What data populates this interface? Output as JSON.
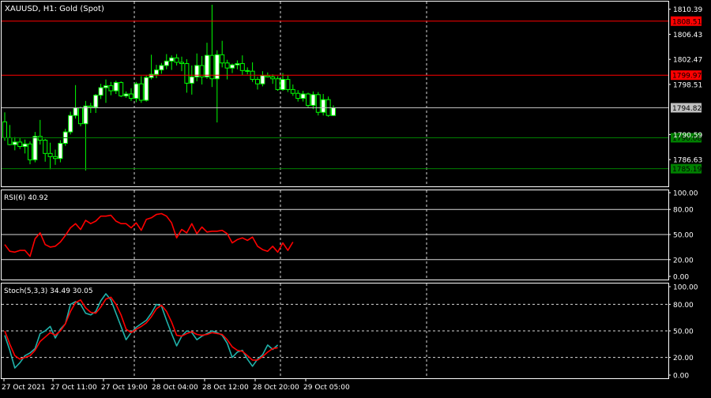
{
  "header": {
    "symbol": "XAUUSD",
    "timeframe": "H1",
    "description": "Gold (Spot)",
    "title_text": "XAUUSD, H1:  Gold (Spot)"
  },
  "colors": {
    "background": "#000000",
    "grid": "#ffffff",
    "bull_candle": "#ffffff",
    "bear_candle": "#000000",
    "wick": "#00ff00",
    "resistance_line": "#ff0000",
    "support_line": "#008000",
    "rsi_line": "#ff0000",
    "stoch_main": "#20b2aa",
    "stoch_signal": "#ff0000",
    "text": "#ffffff",
    "current_price_box": "#c0c0c0"
  },
  "chart_data": [
    {
      "type": "candlestick",
      "name": "price",
      "ylim": [
        1782.4,
        1811.6
      ],
      "y_ticks": [
        "1810.39",
        "1806.43",
        "1802.47",
        "1798.51",
        "1790.59",
        "1786.63"
      ],
      "horizontal_levels": [
        {
          "label": "1808.51",
          "kind": "resistance"
        },
        {
          "label": "1799.97",
          "kind": "resistance"
        },
        {
          "label": "1794.82",
          "kind": "current"
        },
        {
          "label": "1790.08",
          "kind": "support"
        },
        {
          "label": "1785.19",
          "kind": "support"
        }
      ],
      "candles": [
        [
          1792.6,
          1794.1,
          1789.6,
          1790.1
        ],
        [
          1790.1,
          1792.1,
          1788.9,
          1789.0
        ],
        [
          1789.0,
          1790.2,
          1788.1,
          1789.4
        ],
        [
          1789.4,
          1790.0,
          1788.3,
          1788.7
        ],
        [
          1788.7,
          1789.8,
          1787.6,
          1789.1
        ],
        [
          1789.1,
          1789.5,
          1785.9,
          1786.6
        ],
        [
          1786.6,
          1791.0,
          1786.2,
          1790.3
        ],
        [
          1790.3,
          1792.9,
          1789.0,
          1789.7
        ],
        [
          1789.7,
          1789.9,
          1786.3,
          1787.6
        ],
        [
          1787.6,
          1789.3,
          1785.1,
          1787.1
        ],
        [
          1787.1,
          1788.2,
          1785.8,
          1786.8
        ],
        [
          1786.8,
          1789.7,
          1786.2,
          1789.2
        ],
        [
          1789.2,
          1791.5,
          1788.8,
          1791.0
        ],
        [
          1791.0,
          1794.2,
          1790.6,
          1793.6
        ],
        [
          1793.6,
          1798.4,
          1793.1,
          1794.8
        ],
        [
          1794.8,
          1795.0,
          1791.9,
          1792.3
        ],
        [
          1792.3,
          1795.9,
          1784.9,
          1795.1
        ],
        [
          1795.1,
          1795.6,
          1794.0,
          1794.9
        ],
        [
          1794.9,
          1797.0,
          1794.0,
          1796.8
        ],
        [
          1796.8,
          1798.6,
          1796.2,
          1798.0
        ],
        [
          1798.0,
          1799.3,
          1795.6,
          1798.3
        ],
        [
          1798.3,
          1798.9,
          1796.8,
          1797.5
        ],
        [
          1797.5,
          1799.1,
          1797.0,
          1798.8
        ],
        [
          1798.8,
          1799.0,
          1796.5,
          1796.7
        ],
        [
          1796.7,
          1797.4,
          1796.4,
          1797.0
        ],
        [
          1797.0,
          1797.9,
          1795.9,
          1796.3
        ],
        [
          1796.3,
          1798.9,
          1795.7,
          1798.6
        ],
        [
          1798.6,
          1799.8,
          1795.6,
          1796.0
        ],
        [
          1796.0,
          1799.9,
          1795.8,
          1799.6
        ],
        [
          1799.6,
          1803.2,
          1799.3,
          1800.1
        ],
        [
          1800.1,
          1801.6,
          1799.5,
          1800.8
        ],
        [
          1800.8,
          1801.9,
          1800.2,
          1801.5
        ],
        [
          1801.5,
          1803.3,
          1800.9,
          1802.2
        ],
        [
          1802.2,
          1803.1,
          1800.8,
          1802.7
        ],
        [
          1802.7,
          1803.3,
          1801.5,
          1802.0
        ],
        [
          1802.0,
          1802.9,
          1800.6,
          1801.8
        ],
        [
          1801.8,
          1802.5,
          1797.2,
          1798.7
        ],
        [
          1798.7,
          1801.5,
          1796.9,
          1799.7
        ],
        [
          1799.7,
          1803.4,
          1799.0,
          1801.5
        ],
        [
          1801.5,
          1803.0,
          1798.5,
          1799.7
        ],
        [
          1799.7,
          1805.1,
          1799.4,
          1803.1
        ],
        [
          1803.1,
          1811.1,
          1798.1,
          1799.4
        ],
        [
          1799.4,
          1803.9,
          1792.5,
          1803.2
        ],
        [
          1803.2,
          1805.4,
          1801.2,
          1801.9
        ],
        [
          1801.9,
          1802.4,
          1799.3,
          1801.1
        ],
        [
          1801.1,
          1801.8,
          1800.3,
          1801.6
        ],
        [
          1801.6,
          1802.3,
          1800.9,
          1801.8
        ],
        [
          1801.8,
          1803.1,
          1800.0,
          1800.7
        ],
        [
          1800.7,
          1801.2,
          1800.1,
          1800.6
        ],
        [
          1800.6,
          1802.0,
          1798.9,
          1799.3
        ],
        [
          1799.3,
          1799.7,
          1797.7,
          1798.6
        ],
        [
          1798.6,
          1800.6,
          1798.2,
          1799.9
        ],
        [
          1799.9,
          1800.4,
          1799.6,
          1799.7
        ],
        [
          1799.7,
          1800.1,
          1798.6,
          1799.4
        ],
        [
          1799.4,
          1799.8,
          1797.5,
          1797.7
        ],
        [
          1797.7,
          1800.3,
          1797.5,
          1799.3
        ],
        [
          1799.3,
          1799.9,
          1797.3,
          1797.7
        ],
        [
          1797.7,
          1798.5,
          1796.7,
          1797.1
        ],
        [
          1797.1,
          1797.6,
          1795.8,
          1796.3
        ],
        [
          1796.3,
          1797.5,
          1795.8,
          1797.0
        ],
        [
          1797.0,
          1797.2,
          1794.8,
          1795.2
        ],
        [
          1795.2,
          1797.4,
          1794.6,
          1796.9
        ],
        [
          1796.9,
          1797.3,
          1793.6,
          1794.1
        ],
        [
          1794.1,
          1797.0,
          1793.6,
          1796.1
        ],
        [
          1796.1,
          1796.6,
          1793.4,
          1793.6
        ],
        [
          1793.6,
          1795.2,
          1793.5,
          1794.8
        ]
      ]
    },
    {
      "type": "line",
      "name": "RSI(6)",
      "label_text": "RSI(6) 40.92",
      "ylim": [
        0,
        100
      ],
      "y_ticks": [
        "100.00",
        "80.00",
        "50.00",
        "20.00",
        "0.00"
      ],
      "levels": [
        80,
        50,
        20
      ],
      "series": [
        {
          "name": "RSI",
          "values": [
            38,
            30,
            29,
            31,
            31,
            24,
            45,
            52,
            38,
            35,
            36,
            41,
            49,
            58,
            63,
            56,
            67,
            63,
            66,
            72,
            72,
            73,
            66,
            63,
            63,
            58,
            64,
            55,
            68,
            70,
            74,
            75,
            72,
            64,
            46,
            56,
            52,
            63,
            51,
            59,
            53,
            54,
            54,
            55,
            51,
            40,
            44,
            46,
            43,
            47,
            36,
            32,
            30,
            36,
            29,
            40,
            31,
            41
          ]
        }
      ]
    },
    {
      "type": "line",
      "name": "Stoch(5,3,3)",
      "label_text": "Stoch(5,3,3) 34.49 30.05",
      "ylim": [
        0,
        100
      ],
      "y_ticks": [
        "100.00",
        "80.00",
        "50.00",
        "20.00",
        "0.00"
      ],
      "levels": [
        80,
        50,
        20
      ],
      "series": [
        {
          "name": "main",
          "values": [
            45,
            28,
            8,
            14,
            22,
            25,
            30,
            47,
            50,
            55,
            42,
            52,
            58,
            80,
            83,
            80,
            70,
            68,
            72,
            84,
            92,
            85,
            70,
            55,
            40,
            48,
            54,
            58,
            62,
            70,
            80,
            78,
            62,
            47,
            33,
            44,
            50,
            48,
            40,
            44,
            47,
            50,
            48,
            45,
            36,
            20,
            26,
            28,
            18,
            10,
            18,
            23,
            34,
            29,
            34
          ]
        },
        {
          "name": "signal",
          "values": [
            50,
            35,
            22,
            18,
            20,
            22,
            28,
            38,
            43,
            48,
            45,
            50,
            58,
            72,
            82,
            85,
            76,
            71,
            70,
            77,
            86,
            88,
            80,
            68,
            52,
            48,
            52,
            55,
            59,
            66,
            75,
            79,
            72,
            60,
            45,
            44,
            47,
            49,
            46,
            45,
            46,
            48,
            47,
            46,
            40,
            32,
            28,
            27,
            22,
            17,
            17,
            21,
            26,
            30,
            31
          ]
        }
      ]
    }
  ],
  "x_axis": {
    "labels": [
      "27 Oct 2021",
      "27 Oct 11:00",
      "27 Oct 19:00",
      "28 Oct 04:00",
      "28 Oct 12:00",
      "28 Oct 20:00",
      "29 Oct 05:00"
    ]
  }
}
